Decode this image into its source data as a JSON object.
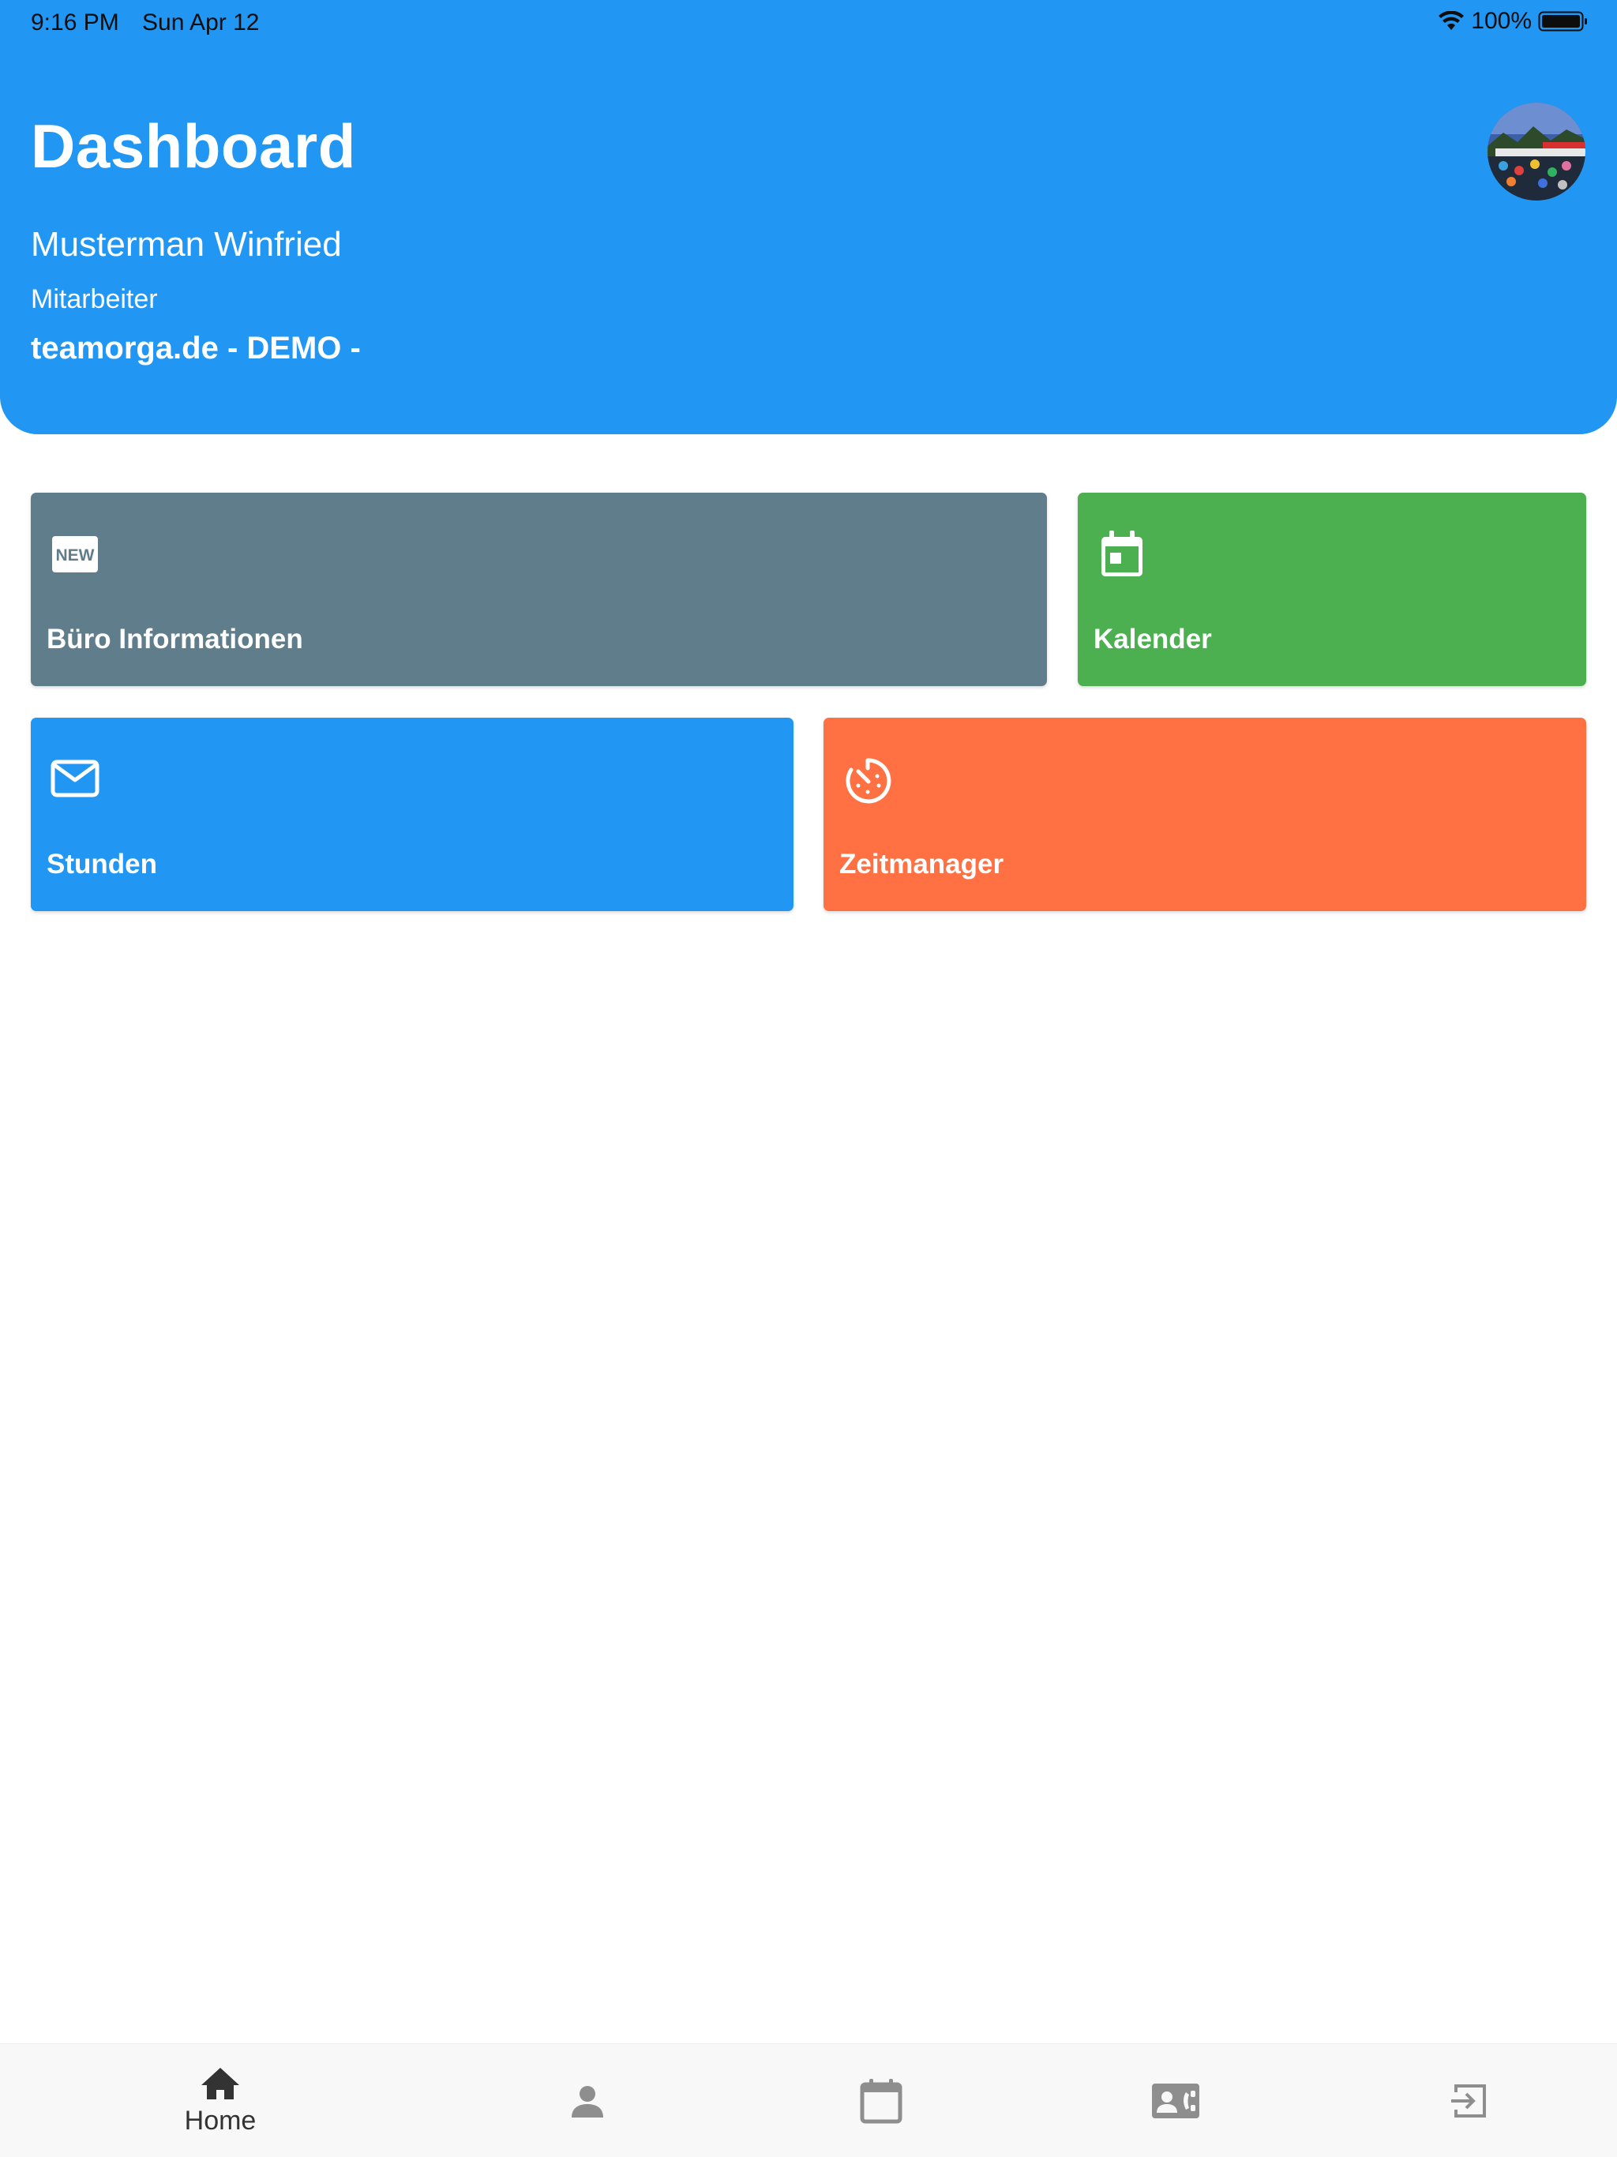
{
  "status_bar": {
    "time": "9:16 PM",
    "date": "Sun Apr 12",
    "battery": "100%"
  },
  "header": {
    "title": "Dashboard",
    "user_name": "Musterman Winfried",
    "role": "Mitarbeiter",
    "company": "teamorga.de - DEMO -"
  },
  "tiles": [
    {
      "label": "Büro Informationen",
      "icon": "new-badge-icon",
      "color": "#607D8B"
    },
    {
      "label": "Kalender",
      "icon": "calendar-icon",
      "color": "#4CAF50"
    },
    {
      "label": "Stunden",
      "icon": "mail-icon",
      "color": "#2196F3"
    },
    {
      "label": "Zeitmanager",
      "icon": "timer-icon",
      "color": "#FF7043"
    }
  ],
  "bottom_nav": [
    {
      "label": "Home",
      "icon": "home-icon",
      "active": true
    },
    {
      "label": "",
      "icon": "person-icon",
      "active": false
    },
    {
      "label": "",
      "icon": "calendar-icon",
      "active": false
    },
    {
      "label": "",
      "icon": "contact-card-icon",
      "active": false
    },
    {
      "label": "",
      "icon": "logout-icon",
      "active": false
    }
  ],
  "colors": {
    "primary": "#2196F3",
    "nav_active": "#333333",
    "nav_inactive": "#8e8e8e"
  }
}
